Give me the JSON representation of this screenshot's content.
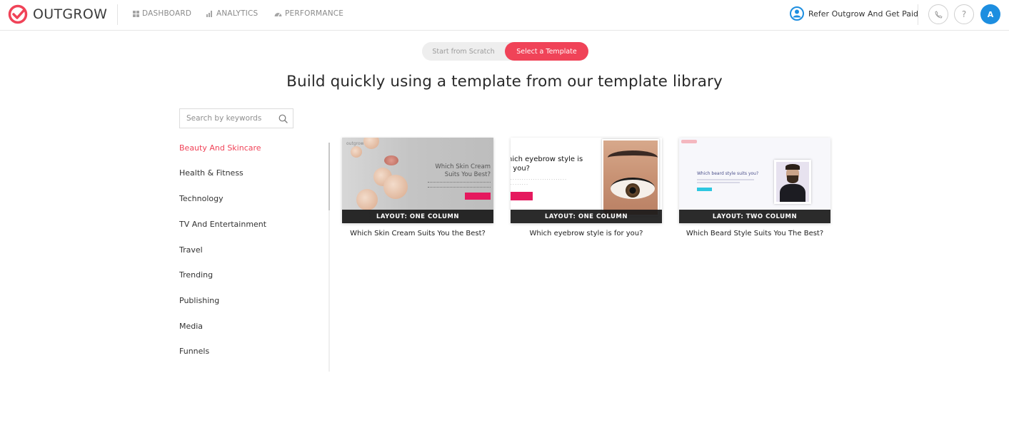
{
  "header": {
    "brand": "OUTGROW",
    "nav": [
      {
        "label": "DASHBOARD",
        "icon": "grid-icon"
      },
      {
        "label": "ANALYTICS",
        "icon": "bar-chart-icon"
      },
      {
        "label": "PERFORMANCE",
        "icon": "gauge-icon"
      }
    ],
    "refer_label": "Refer Outgrow And Get Paid",
    "help_label": "?",
    "avatar_initial": "A"
  },
  "toggle": {
    "scratch_label": "Start from Scratch",
    "template_label": "Select a Template",
    "selected": "Select a Template"
  },
  "headline": "Build quickly using a template from our template library",
  "search": {
    "placeholder": "Search by keywords",
    "value": ""
  },
  "categories": [
    {
      "label": "Beauty And Skincare",
      "active": true
    },
    {
      "label": "Health & Fitness",
      "active": false
    },
    {
      "label": "Technology",
      "active": false
    },
    {
      "label": "TV And Entertainment",
      "active": false
    },
    {
      "label": "Travel",
      "active": false
    },
    {
      "label": "Trending",
      "active": false
    },
    {
      "label": "Publishing",
      "active": false
    },
    {
      "label": "Media",
      "active": false
    },
    {
      "label": "Funnels",
      "active": false
    }
  ],
  "templates": [
    {
      "layout": "LAYOUT: ONE COLUMN",
      "title": "Which Skin Cream Suits You the Best?",
      "preview_heading": "Which Skin Cream Suits You Best?"
    },
    {
      "layout": "LAYOUT: ONE COLUMN",
      "title": "Which eyebrow style is for you?",
      "preview_heading": "hich eyebrow style is r you?"
    },
    {
      "layout": "LAYOUT: TWO COLUMN",
      "title": "Which Beard Style Suits You The Best?",
      "preview_heading": "Which beard style suits you?"
    }
  ],
  "colors": {
    "accent": "#f04358",
    "avatar": "#1d8ee0",
    "cta_pink": "#e5195e",
    "cta_cyan": "#2ec7e0"
  }
}
